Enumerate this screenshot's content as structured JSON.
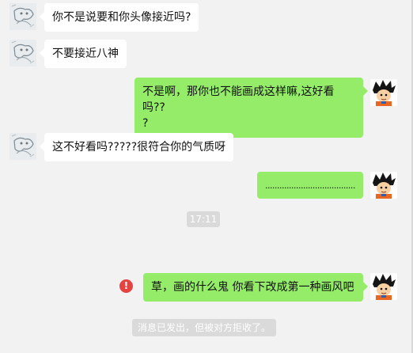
{
  "messages": [
    {
      "side": "in",
      "text": "你不是说要和你头像接近吗?"
    },
    {
      "side": "in",
      "text": "不要接近八神"
    },
    {
      "side": "out",
      "line1": "不是啊，那你也不能画成这样嘛,这好看吗??",
      "line2": "?"
    },
    {
      "side": "in",
      "text": "这不好看吗?????很符合你的气质呀"
    },
    {
      "side": "out",
      "text": "......................................"
    },
    {
      "side": "out",
      "text": "草，画的什么鬼  你看下改成第一种画风吧",
      "status": "failed"
    }
  ],
  "timestamp": "17:11",
  "system_notice": "消息已发出，但被对方拒收了。",
  "error_icon_glyph": "!",
  "colors": {
    "background": "#f2f2f2",
    "incoming_bubble": "#ffffff",
    "outgoing_bubble": "#95ec69",
    "error": "#e64340",
    "notice_bg": "#dadada"
  },
  "icons": {
    "left_avatar": "sketch-avatar-icon",
    "right_avatar": "goku-avatar-icon"
  }
}
